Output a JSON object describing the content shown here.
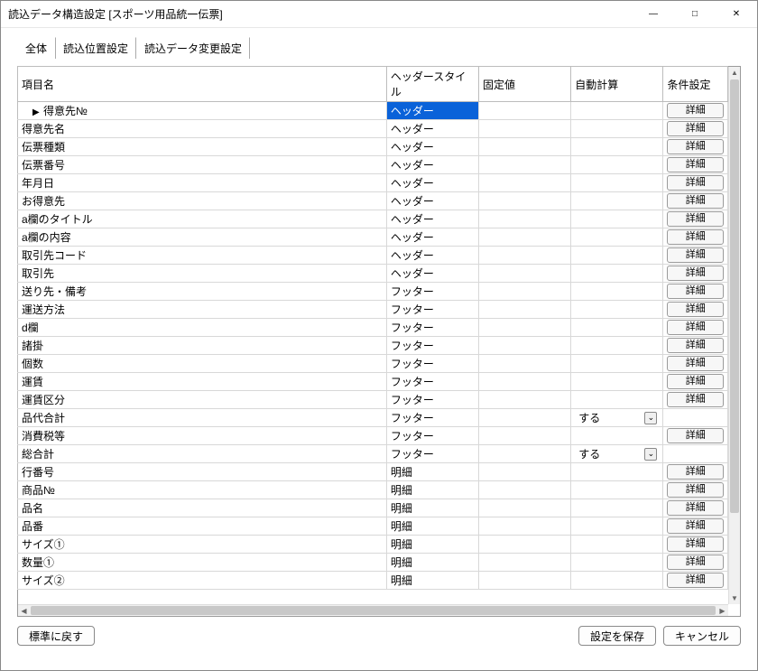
{
  "window": {
    "title": "読込データ構造設定 [スポーツ用品統一伝票]"
  },
  "tabs": {
    "t0": "全体",
    "t1": "読込位置設定",
    "t2": "読込データ変更設定"
  },
  "columns": {
    "item": "項目名",
    "style": "ヘッダースタイル",
    "fixed": "固定値",
    "auto": "自動計算",
    "cond": "条件設定"
  },
  "style_labels": {
    "header": "ヘッダー",
    "footer": "フッター",
    "detail": "明細"
  },
  "auto_value": "する",
  "detail_btn": "詳細",
  "rows": [
    {
      "name": "得意先№",
      "style": "header",
      "auto": "gray",
      "cond": "btn",
      "selected": true
    },
    {
      "name": "得意先名",
      "style": "header",
      "auto": "gray",
      "cond": "btn"
    },
    {
      "name": "伝票種類",
      "style": "header",
      "auto": "gray",
      "cond": "btn"
    },
    {
      "name": "伝票番号",
      "style": "header",
      "auto": "gray",
      "cond": "btn"
    },
    {
      "name": "年月日",
      "style": "header",
      "auto": "gray",
      "cond": "btn"
    },
    {
      "name": "お得意先",
      "style": "header",
      "auto": "gray",
      "cond": "btn"
    },
    {
      "name": "a欄のタイトル",
      "style": "header",
      "auto": "gray",
      "cond": "btn"
    },
    {
      "name": "a欄の内容",
      "style": "header",
      "auto": "gray",
      "cond": "btn"
    },
    {
      "name": "取引先コード",
      "style": "header",
      "auto": "gray",
      "cond": "btn"
    },
    {
      "name": "取引先",
      "style": "header",
      "auto": "gray",
      "cond": "btn"
    },
    {
      "name": "送り先・備考",
      "style": "footer",
      "auto": "gray",
      "cond": "btn"
    },
    {
      "name": "運送方法",
      "style": "footer",
      "auto": "gray",
      "cond": "btn"
    },
    {
      "name": "d欄",
      "style": "footer",
      "auto": "gray",
      "cond": "btn"
    },
    {
      "name": "諸掛",
      "style": "footer",
      "auto": "gray",
      "cond": "btn"
    },
    {
      "name": "個数",
      "style": "footer",
      "auto": "gray",
      "cond": "btn"
    },
    {
      "name": "運賃",
      "style": "footer",
      "auto": "gray",
      "cond": "btn"
    },
    {
      "name": "運賃区分",
      "style": "footer",
      "auto": "gray",
      "cond": "btn"
    },
    {
      "name": "品代合計",
      "style": "footer",
      "auto": "drop",
      "cond": "gray"
    },
    {
      "name": "消費税等",
      "style": "footer",
      "auto": "gray",
      "cond": "btn"
    },
    {
      "name": "総合計",
      "style": "footer",
      "auto": "drop",
      "cond": "gray"
    },
    {
      "name": "行番号",
      "style": "detail",
      "auto": "gray",
      "cond": "btn"
    },
    {
      "name": "商品№",
      "style": "detail",
      "auto": "gray",
      "cond": "btn"
    },
    {
      "name": "品名",
      "style": "detail",
      "auto": "gray",
      "cond": "btn"
    },
    {
      "name": "品番",
      "style": "detail",
      "auto": "gray",
      "cond": "btn"
    },
    {
      "name": "サイズ①",
      "style": "detail",
      "auto": "gray",
      "cond": "btn"
    },
    {
      "name": "数量①",
      "style": "detail",
      "auto": "gray",
      "cond": "btn"
    },
    {
      "name": "サイズ②",
      "style": "detail",
      "auto": "gray",
      "cond": "btn"
    }
  ],
  "footer": {
    "reset": "標準に戻す",
    "save": "設定を保存",
    "cancel": "キャンセル"
  }
}
